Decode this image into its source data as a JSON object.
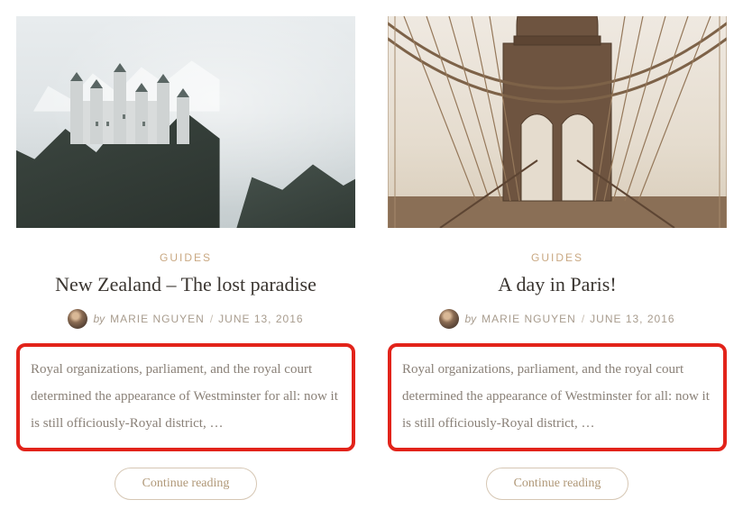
{
  "posts": [
    {
      "category": "GUIDES",
      "title": "New Zealand – The lost paradise",
      "by": "by",
      "author": "MARIE NGUYEN",
      "sep": "/",
      "date": "JUNE 13, 2016",
      "excerpt": "Royal organizations, parliament, and the royal court determined the appearance of Westminster for all: now it is still officiously-Royal district, …",
      "more": "Continue reading"
    },
    {
      "category": "GUIDES",
      "title": "A day in Paris!",
      "by": "by",
      "author": "MARIE NGUYEN",
      "sep": "/",
      "date": "JUNE 13, 2016",
      "excerpt": "Royal organizations, parliament, and the royal court determined the appearance of Westminster for all: now it is still officiously-Royal district, …",
      "more": "Continue reading"
    }
  ]
}
